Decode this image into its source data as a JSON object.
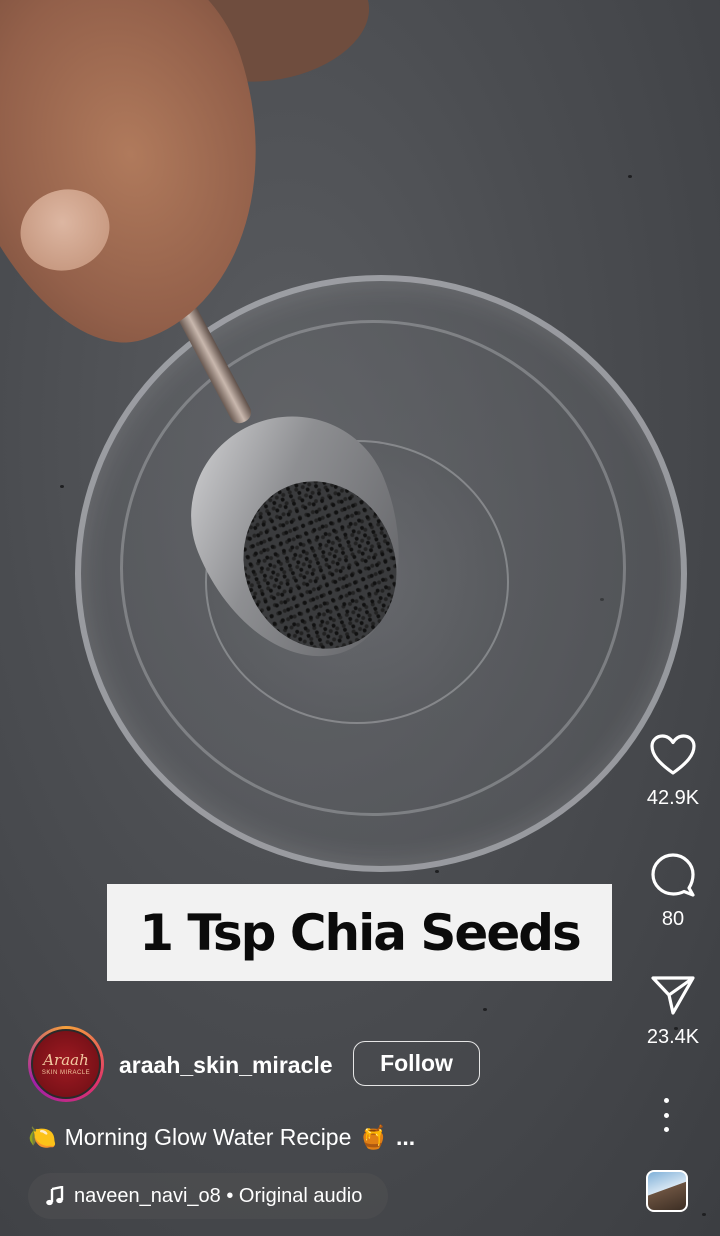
{
  "video": {
    "overlay_text": "1 Tsp Chia Seeds"
  },
  "actions": {
    "likes": "42.9K",
    "comments": "80",
    "shares": "23.4K"
  },
  "author": {
    "avatar_brand": "Araah",
    "avatar_sub": "SKIN MIRACLE",
    "username": "araah_skin_miracle",
    "follow_label": "Follow"
  },
  "caption": {
    "leading_emoji": "🍋",
    "text": "Morning Glow Water Recipe",
    "trailing_emoji": "🍯",
    "more": "..."
  },
  "audio": {
    "label": "naveen_navi_o8 • Original audio"
  },
  "icons": [
    "heart-icon",
    "comment-icon",
    "share-icon",
    "more-icon",
    "music-note-icon"
  ]
}
